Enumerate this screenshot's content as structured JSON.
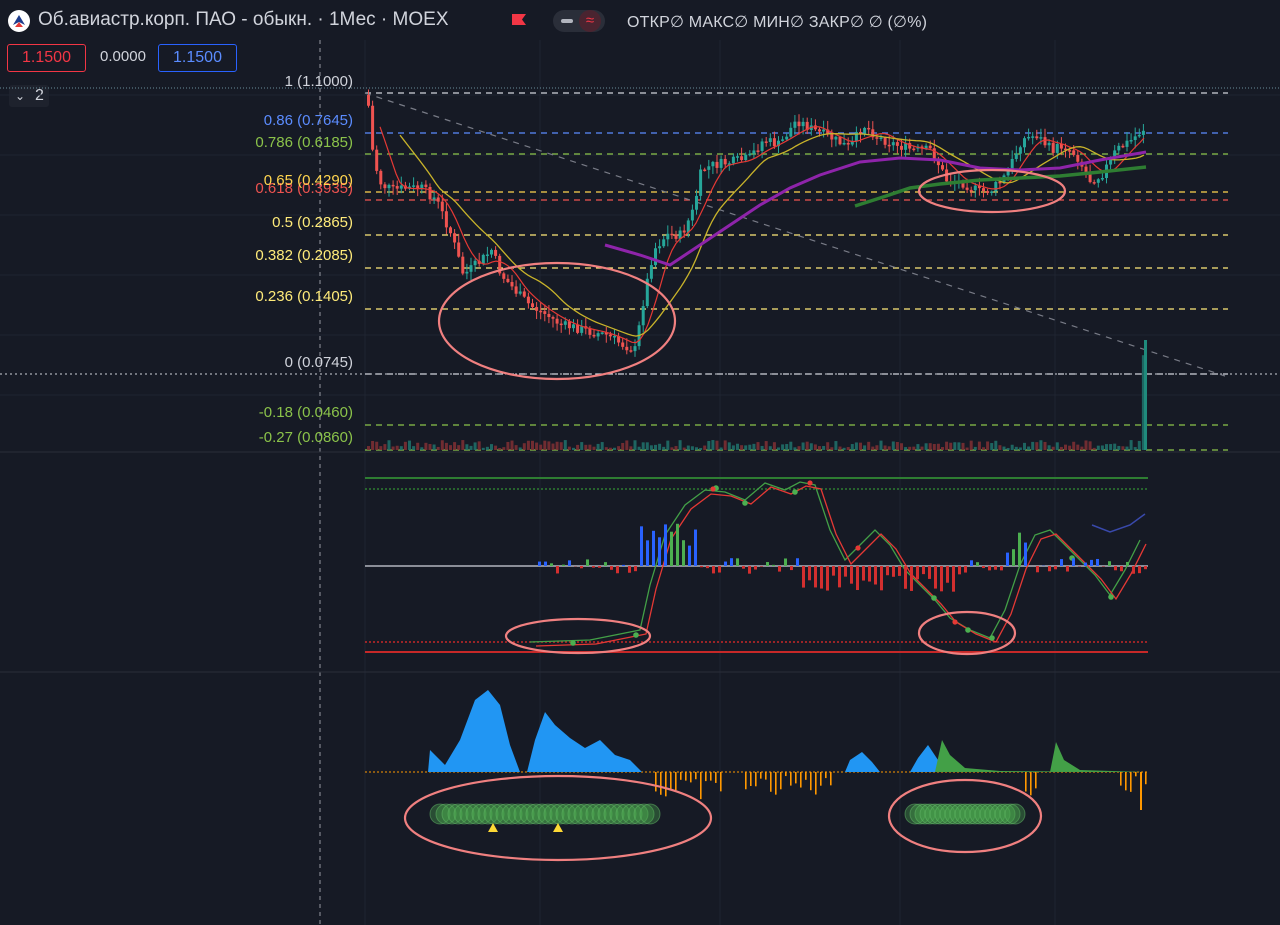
{
  "header": {
    "title": "Об.авиастр.корп. ПАО - обыкн. · 1Мес · MOEX",
    "ohlc": "ОТКР∅ МАКС∅ МИН∅ ЗАКР∅ ∅ (∅%)",
    "flag_color": "#f23645"
  },
  "price_boxes": {
    "sell": "1.1500",
    "spread": "0.0000",
    "buy": "1.1500"
  },
  "indicators_collapse": {
    "icon": "chevron-down-icon",
    "count": "2"
  },
  "fib_levels": [
    {
      "label": "1 (1.1000)",
      "color": "#d1d4dc"
    },
    {
      "label": "0.86 (0.7645)",
      "color": "#5b8cff"
    },
    {
      "label": "0.786 (0.6185)",
      "color": "#8bc34a"
    },
    {
      "label": "0.65 (0.4290)",
      "color": "#ffd54f"
    },
    {
      "label": "0.618 (0.3935)",
      "color": "#ef5350"
    },
    {
      "label": "0.5 (0.2865)",
      "color": "#ffeb7a"
    },
    {
      "label": "0.382 (0.2085)",
      "color": "#ffeb7a"
    },
    {
      "label": "0.236 (0.1405)",
      "color": "#ffeb7a"
    },
    {
      "label": "0 (0.0745)",
      "color": "#d1d4dc"
    },
    {
      "label": "-0.18 (0.0460)",
      "color": "#8bc34a"
    },
    {
      "label": "-0.27 (0.0860)",
      "color": "#8bc34a"
    }
  ],
  "colors": {
    "background": "#161a25",
    "up": "#26a69a",
    "down": "#ef5350",
    "annotation": "#f08080",
    "area": "#2196f3"
  }
}
